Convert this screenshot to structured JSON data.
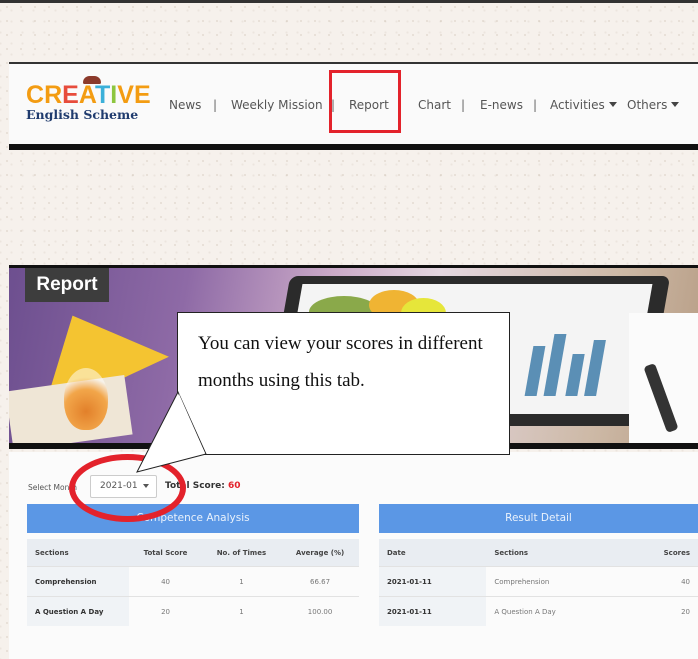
{
  "nav": {
    "logo": {
      "line1": "CREATIVE",
      "line2": "English Scheme"
    },
    "items": [
      {
        "label": "News"
      },
      {
        "label": "Weekly Mission"
      },
      {
        "label": "Report"
      },
      {
        "label": "Chart"
      },
      {
        "label": "E-news"
      },
      {
        "label": "Activities"
      },
      {
        "label": "Others"
      }
    ],
    "separator": "|"
  },
  "banner": {
    "title": "Report"
  },
  "callout": {
    "text": "You can view your scores in different months using this tab."
  },
  "filter": {
    "label": "Select Month",
    "selected_month": "2021-01",
    "total_score_label": "Total Score:",
    "total_score_value": "60"
  },
  "competence": {
    "heading": "Competence Analysis",
    "columns": [
      "Sections",
      "Total Score",
      "No. of Times",
      "Average (%)"
    ],
    "rows": [
      [
        "Comprehension",
        "40",
        "1",
        "66.67"
      ],
      [
        "A Question A Day",
        "20",
        "1",
        "100.00"
      ]
    ]
  },
  "result": {
    "heading": "Result Detail",
    "columns": [
      "Date",
      "Sections",
      "Scores"
    ],
    "rows": [
      [
        "2021-01-11",
        "Comprehension",
        "40"
      ],
      [
        "2021-01-11",
        "A Question A Day",
        "20"
      ]
    ]
  },
  "colors": {
    "accent": "#5b97e5",
    "highlight": "#e3222b",
    "score": "#e3222b"
  }
}
